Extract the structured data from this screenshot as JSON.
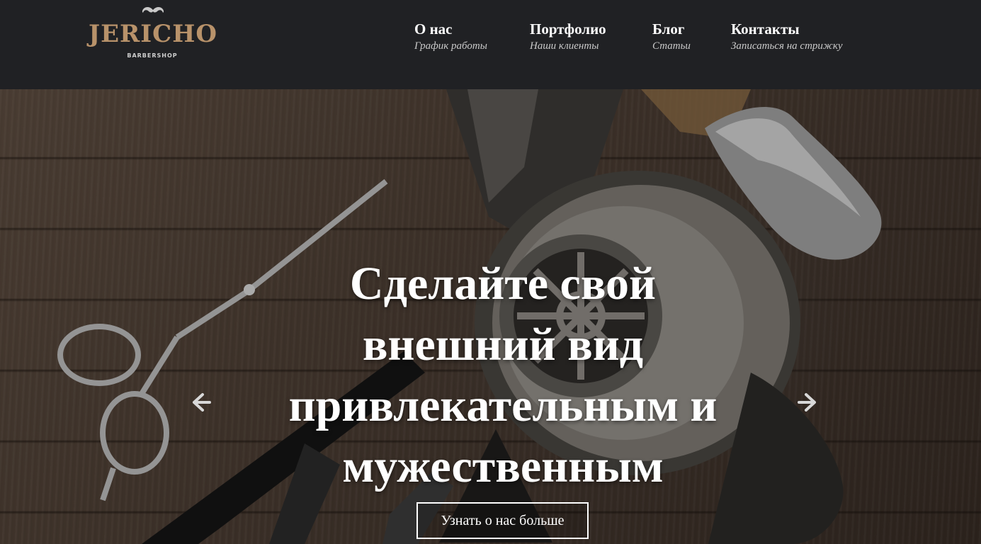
{
  "brand": {
    "name": "JERICHO",
    "tagline": "BARBERSHOP",
    "logo_icon": "mustache-icon"
  },
  "nav": [
    {
      "title": "О нас",
      "subtitle": "График работы"
    },
    {
      "title": "Портфолио",
      "subtitle": "Наши клиенты"
    },
    {
      "title": "Блог",
      "subtitle": "Статьи"
    },
    {
      "title": "Контакты",
      "subtitle": "Записаться на стрижку"
    }
  ],
  "hero": {
    "headline": "Сделайте свой внешний вид привлекательным и мужественным",
    "cta_label": "Узнать о нас больше",
    "prev_icon": "arrow-left-icon",
    "next_icon": "arrow-right-icon"
  },
  "colors": {
    "header_bg": "#202124",
    "brand_gold": "#b8926a",
    "text_white": "#ffffff"
  }
}
